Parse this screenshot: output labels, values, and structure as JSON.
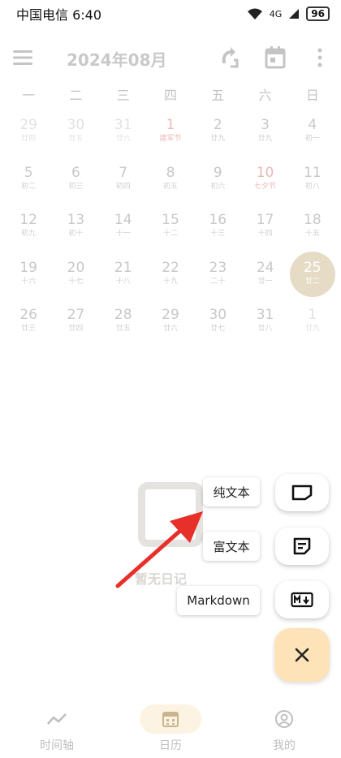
{
  "status": {
    "carrier_time": "中国电信 6:40",
    "network": "4G",
    "battery": "96"
  },
  "header": {
    "month_title": "2024年08月"
  },
  "weekdays": [
    "一",
    "二",
    "三",
    "四",
    "五",
    "六",
    "日"
  ],
  "weeks": [
    [
      {
        "d": "29",
        "l": "廿四",
        "t": "prev"
      },
      {
        "d": "30",
        "l": "廿五",
        "t": "prev"
      },
      {
        "d": "31",
        "l": "廿六",
        "t": "prev"
      },
      {
        "d": "1",
        "l": "建军节",
        "t": "hol"
      },
      {
        "d": "2",
        "l": "廿九",
        "t": ""
      },
      {
        "d": "3",
        "l": "廿九",
        "t": ""
      },
      {
        "d": "4",
        "l": "初一",
        "t": ""
      }
    ],
    [
      {
        "d": "5",
        "l": "初二",
        "t": ""
      },
      {
        "d": "6",
        "l": "初三",
        "t": ""
      },
      {
        "d": "7",
        "l": "初四",
        "t": ""
      },
      {
        "d": "8",
        "l": "初五",
        "t": ""
      },
      {
        "d": "9",
        "l": "初六",
        "t": ""
      },
      {
        "d": "10",
        "l": "七夕节",
        "t": "hol"
      },
      {
        "d": "11",
        "l": "初八",
        "t": ""
      }
    ],
    [
      {
        "d": "12",
        "l": "初九",
        "t": ""
      },
      {
        "d": "13",
        "l": "初十",
        "t": ""
      },
      {
        "d": "14",
        "l": "十一",
        "t": ""
      },
      {
        "d": "15",
        "l": "十二",
        "t": ""
      },
      {
        "d": "16",
        "l": "十三",
        "t": ""
      },
      {
        "d": "17",
        "l": "十四",
        "t": ""
      },
      {
        "d": "18",
        "l": "十五",
        "t": ""
      }
    ],
    [
      {
        "d": "19",
        "l": "十六",
        "t": ""
      },
      {
        "d": "20",
        "l": "十七",
        "t": ""
      },
      {
        "d": "21",
        "l": "十八",
        "t": ""
      },
      {
        "d": "22",
        "l": "十九",
        "t": ""
      },
      {
        "d": "23",
        "l": "二十",
        "t": ""
      },
      {
        "d": "24",
        "l": "廿一",
        "t": ""
      },
      {
        "d": "25",
        "l": "廿二",
        "t": "today"
      }
    ],
    [
      {
        "d": "26",
        "l": "廿三",
        "t": ""
      },
      {
        "d": "27",
        "l": "廿四",
        "t": ""
      },
      {
        "d": "28",
        "l": "廿五",
        "t": ""
      },
      {
        "d": "29",
        "l": "廿六",
        "t": ""
      },
      {
        "d": "30",
        "l": "廿七",
        "t": ""
      },
      {
        "d": "31",
        "l": "廿八",
        "t": ""
      },
      {
        "d": "1",
        "l": "廿九",
        "t": "prev"
      }
    ]
  ],
  "empty_state": {
    "label": "暂无日记"
  },
  "menu": {
    "plain_text": "纯文本",
    "rich_text": "富文本",
    "markdown": "Markdown"
  },
  "nav": [
    {
      "label": "时间轴",
      "icon": "timeline-icon"
    },
    {
      "label": "日历",
      "icon": "calendar-icon"
    },
    {
      "label": "我的",
      "icon": "profile-icon"
    }
  ],
  "colors": {
    "accent": "#e6dcc6",
    "fab_close": "#fde3b7",
    "holiday": "#eab9b6",
    "arrow": "#e8302a"
  }
}
